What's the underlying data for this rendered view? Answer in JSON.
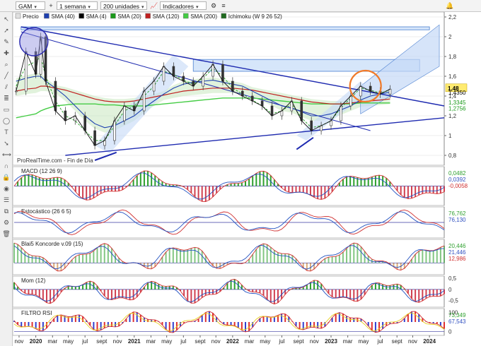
{
  "toolbar": {
    "symbol": "GAM",
    "period": "1 semana",
    "units": "200 unidades",
    "indicators": "Indicadores"
  },
  "icons": {
    "symbol_dropdown": "chevron-down-icon",
    "add": "plus-icon",
    "indicators": "chart-icon",
    "settings": "gear-icon",
    "lines": "lines-icon",
    "alert": "bell-icon",
    "menu": "menu-icon"
  },
  "legend": {
    "items": [
      {
        "label": "Precio",
        "color": "#e0e0e0"
      },
      {
        "label": "SMA (40)",
        "color": "#1e40b0"
      },
      {
        "label": "SMA (4)",
        "color": "#000000"
      },
      {
        "label": "SMA (20)",
        "color": "#1a9a1a"
      },
      {
        "label": "SMA (120)",
        "color": "#c02020"
      },
      {
        "label": "SMA (200)",
        "color": "#44cc44"
      },
      {
        "label": "Ichimoku (W 9 26 52)",
        "color": "#1e6a1e"
      }
    ]
  },
  "source_text": "ProRealTime.com - Fin de Día",
  "chart_data": [
    {
      "type": "candlestick",
      "title": "",
      "ylim": [
        0.7,
        2.25
      ],
      "yticks": [
        0.8,
        1.0,
        1.2,
        1.4,
        1.6,
        1.8,
        2.0,
        2.2
      ],
      "ytick_labels": [
        "0,8",
        "1",
        "1,2",
        "1,4",
        "1,6",
        "1,8",
        "2",
        "2,2"
      ],
      "x_labels": [
        "nov",
        "2020",
        "mar",
        "may",
        "jul",
        "sept",
        "nov",
        "2021",
        "mar",
        "may",
        "jul",
        "sept",
        "nov",
        "2022",
        "mar",
        "may",
        "jul",
        "sept",
        "nov",
        "2023",
        "mar",
        "may",
        "jul",
        "sept",
        "nov",
        "2024"
      ],
      "x": [
        2019.8,
        2019.9,
        2020.0,
        2020.05,
        2020.1,
        2020.2,
        2020.3,
        2020.4,
        2020.5,
        2020.6,
        2020.7,
        2020.8,
        2020.9,
        2021.0,
        2021.1,
        2021.2,
        2021.3,
        2021.4,
        2021.5,
        2021.6,
        2021.7,
        2021.8,
        2021.9,
        2022.0,
        2022.1,
        2022.2,
        2022.3,
        2022.4,
        2022.5,
        2022.6,
        2022.7,
        2022.8,
        2022.9,
        2023.0,
        2023.1,
        2023.2,
        2023.3,
        2023.4,
        2023.5,
        2023.6
      ],
      "close": [
        1.45,
        1.85,
        1.62,
        2.0,
        1.55,
        1.25,
        1.15,
        1.2,
        1.05,
        0.9,
        0.95,
        1.15,
        1.3,
        1.25,
        1.45,
        1.55,
        1.7,
        1.6,
        1.55,
        1.5,
        1.6,
        1.72,
        1.55,
        1.45,
        1.4,
        1.35,
        1.3,
        1.2,
        1.25,
        1.35,
        1.15,
        1.05,
        1.1,
        1.15,
        1.3,
        1.4,
        1.5,
        1.45,
        1.42,
        1.47
      ],
      "current_price_label": "1,48",
      "right_labels": [
        {
          "label": "1,4350",
          "value": 1.435,
          "bg": "#ffffff",
          "fg": "#000000"
        },
        {
          "label": "1,3345",
          "value": 1.3345,
          "bg": "#ffffff",
          "fg": "#1a9a1a"
        },
        {
          "label": "1,2756",
          "value": 1.2756,
          "bg": "#ffffff",
          "fg": "#1a9a1a"
        }
      ],
      "sma_4_close": [
        1.5,
        1.7,
        1.75,
        1.8,
        1.6,
        1.35,
        1.2,
        1.15,
        1.05,
        0.95,
        0.95,
        1.1,
        1.25,
        1.3,
        1.4,
        1.5,
        1.65,
        1.62,
        1.56,
        1.52,
        1.58,
        1.68,
        1.6,
        1.48,
        1.42,
        1.36,
        1.3,
        1.22,
        1.25,
        1.32,
        1.18,
        1.08,
        1.1,
        1.15,
        1.28,
        1.38,
        1.48,
        1.46,
        1.43,
        1.46
      ],
      "sma_40": [
        1.55,
        1.58,
        1.6,
        1.6,
        1.55,
        1.48,
        1.4,
        1.3,
        1.2,
        1.12,
        1.08,
        1.1,
        1.15,
        1.2,
        1.28,
        1.35,
        1.42,
        1.48,
        1.52,
        1.54,
        1.55,
        1.56,
        1.54,
        1.52,
        1.5,
        1.45,
        1.4,
        1.35,
        1.3,
        1.28,
        1.24,
        1.2,
        1.2,
        1.22,
        1.26,
        1.3,
        1.36,
        1.4,
        1.42,
        1.44
      ],
      "sma_120": [
        1.45,
        1.47,
        1.48,
        1.5,
        1.5,
        1.48,
        1.46,
        1.43,
        1.4,
        1.37,
        1.35,
        1.34,
        1.34,
        1.35,
        1.37,
        1.39,
        1.41,
        1.43,
        1.45,
        1.46,
        1.47,
        1.48,
        1.48,
        1.48,
        1.47,
        1.46,
        1.44,
        1.42,
        1.4,
        1.38,
        1.36,
        1.34,
        1.33,
        1.32,
        1.32,
        1.33,
        1.34,
        1.35,
        1.36,
        1.37
      ],
      "sma_200": [
        1.18,
        1.2,
        1.22,
        1.25,
        1.27,
        1.3,
        1.31,
        1.32,
        1.32,
        1.32,
        1.31,
        1.31,
        1.3,
        1.3,
        1.3,
        1.31,
        1.32,
        1.33,
        1.34,
        1.35,
        1.36,
        1.37,
        1.38,
        1.38,
        1.38,
        1.38,
        1.37,
        1.36,
        1.35,
        1.34,
        1.33,
        1.32,
        1.32,
        1.32,
        1.32,
        1.32,
        1.33,
        1.33,
        1.33,
        1.33
      ]
    },
    {
      "type": "line",
      "title": "MACD (12 26 9)",
      "ylim": [
        -0.06,
        0.06
      ],
      "right_labels": [
        "0,0482",
        "0,0392",
        "-0,0058"
      ]
    },
    {
      "type": "line",
      "title": "Estocástico (26 6 5)",
      "ylim": [
        0,
        100
      ],
      "right_labels": [
        "76,762",
        "76,130"
      ]
    },
    {
      "type": "line",
      "title": "Blai5 Koncorde v.09 (15)",
      "ylim": [
        -20,
        40
      ],
      "right_labels": [
        "20,446",
        "21,446",
        "12,986"
      ]
    },
    {
      "type": "bar",
      "title": "Mom (12)",
      "ylim": [
        -0.8,
        0.6
      ],
      "yticks": [
        0.5,
        0.0,
        -0.5
      ],
      "ytick_labels": [
        "0,5",
        "0",
        "-0,5"
      ]
    },
    {
      "type": "line",
      "title": "FILTRO RSI",
      "ylim": [
        -20,
        120
      ],
      "yticks": [
        100,
        0
      ],
      "ytick_labels": [
        "100",
        "0"
      ],
      "right_labels": [
        "73,349",
        "67,543"
      ]
    }
  ]
}
